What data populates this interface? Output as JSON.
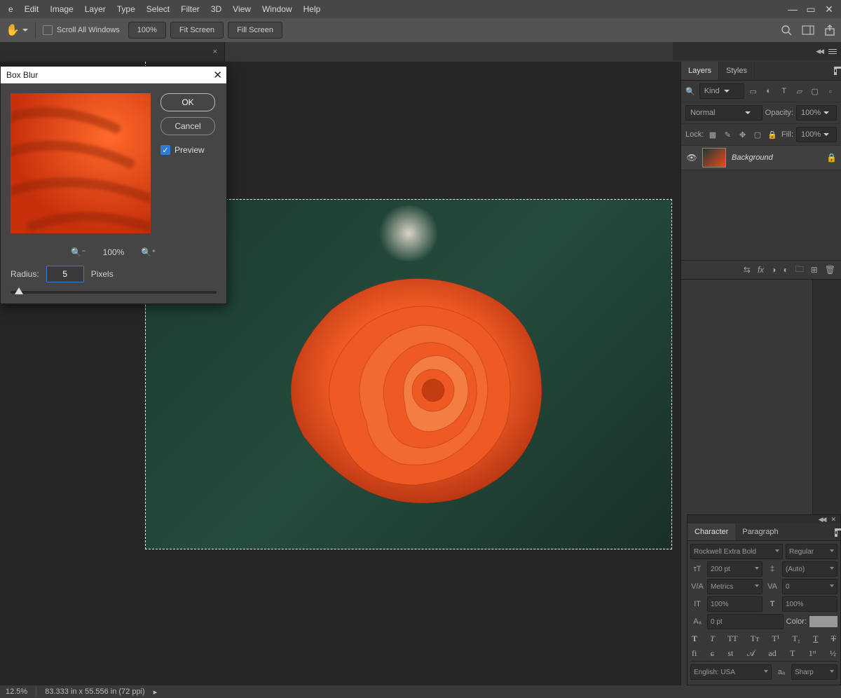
{
  "menu": [
    "e",
    "Edit",
    "Image",
    "Layer",
    "Type",
    "Select",
    "Filter",
    "3D",
    "View",
    "Window",
    "Help"
  ],
  "optbar": {
    "scroll_all": "Scroll All Windows",
    "zoom": "100%",
    "fit": "Fit Screen",
    "fill": "Fill Screen"
  },
  "tab": {
    "close": "×"
  },
  "layers_panel": {
    "tabs": [
      "Layers",
      "Styles"
    ],
    "kind": "Kind",
    "blend": "Normal",
    "opacity_lbl": "Opacity:",
    "opacity_val": "100%",
    "lock_lbl": "Lock:",
    "fill_lbl": "Fill:",
    "fill_val": "100%",
    "layer_name": "Background"
  },
  "dialog": {
    "title": "Box Blur",
    "ok": "OK",
    "cancel": "Cancel",
    "preview": "Preview",
    "zoom": "100%",
    "radius_lbl": "Radius:",
    "radius_val": "5",
    "radius_unit": "Pixels"
  },
  "char_panel": {
    "tabs": [
      "Character",
      "Paragraph"
    ],
    "font": "Rockwell Extra Bold",
    "style": "Regular",
    "size": "200 pt",
    "leading": "(Auto)",
    "kerning": "Metrics",
    "tracking": "0",
    "vscale": "100%",
    "hscale": "100%",
    "baseline": "0 pt",
    "color_lbl": "Color:",
    "lang": "English: USA",
    "aa": "Sharp"
  },
  "status": {
    "zoom": "12.5%",
    "info": "83.333 in x 55.556 in (72 ppi)"
  }
}
